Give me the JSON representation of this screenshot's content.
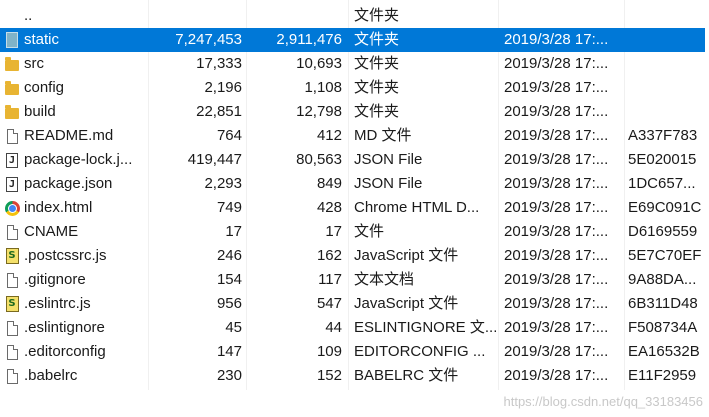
{
  "rows": [
    {
      "icon": "parent-folder-icon",
      "name": "..",
      "size": "",
      "packed": "",
      "type": "文件夹",
      "modified": "",
      "crc": ""
    },
    {
      "icon": "folder-icon",
      "name": "static",
      "size": "7,247,453",
      "packed": "2,911,476",
      "type": "文件夹",
      "modified": "2019/3/28 17:...",
      "crc": "",
      "selected": true
    },
    {
      "icon": "folder-icon",
      "name": "src",
      "size": "17,333",
      "packed": "10,693",
      "type": "文件夹",
      "modified": "2019/3/28 17:...",
      "crc": ""
    },
    {
      "icon": "folder-icon",
      "name": "config",
      "size": "2,196",
      "packed": "1,108",
      "type": "文件夹",
      "modified": "2019/3/28 17:...",
      "crc": ""
    },
    {
      "icon": "folder-icon",
      "name": "build",
      "size": "22,851",
      "packed": "12,798",
      "type": "文件夹",
      "modified": "2019/3/28 17:...",
      "crc": ""
    },
    {
      "icon": "file-icon",
      "name": "README.md",
      "size": "764",
      "packed": "412",
      "type": "MD 文件",
      "modified": "2019/3/28 17:...",
      "crc": "A337F783"
    },
    {
      "icon": "json-file-icon",
      "name": "package-lock.j...",
      "size": "419,447",
      "packed": "80,563",
      "type": "JSON File",
      "modified": "2019/3/28 17:...",
      "crc": "5E020015"
    },
    {
      "icon": "json-file-icon",
      "name": "package.json",
      "size": "2,293",
      "packed": "849",
      "type": "JSON File",
      "modified": "2019/3/28 17:...",
      "crc": "1DC657..."
    },
    {
      "icon": "chrome-icon",
      "name": "index.html",
      "size": "749",
      "packed": "428",
      "type": "Chrome HTML D...",
      "modified": "2019/3/28 17:...",
      "crc": "E69C091C"
    },
    {
      "icon": "file-icon",
      "name": "CNAME",
      "size": "17",
      "packed": "17",
      "type": "文件",
      "modified": "2019/3/28 17:...",
      "crc": "D6169559"
    },
    {
      "icon": "js-file-icon",
      "name": ".postcssrc.js",
      "size": "246",
      "packed": "162",
      "type": "JavaScript 文件",
      "modified": "2019/3/28 17:...",
      "crc": "5E7C70EF"
    },
    {
      "icon": "file-icon",
      "name": ".gitignore",
      "size": "154",
      "packed": "117",
      "type": "文本文档",
      "modified": "2019/3/28 17:...",
      "crc": "9A88DA..."
    },
    {
      "icon": "js-file-icon",
      "name": ".eslintrc.js",
      "size": "956",
      "packed": "547",
      "type": "JavaScript 文件",
      "modified": "2019/3/28 17:...",
      "crc": "6B311D48"
    },
    {
      "icon": "file-icon",
      "name": ".eslintignore",
      "size": "45",
      "packed": "44",
      "type": "ESLINTIGNORE 文...",
      "modified": "2019/3/28 17:...",
      "crc": "F508734A"
    },
    {
      "icon": "file-icon",
      "name": ".editorconfig",
      "size": "147",
      "packed": "109",
      "type": "EDITORCONFIG ...",
      "modified": "2019/3/28 17:...",
      "crc": "EA16532B"
    },
    {
      "icon": "file-icon",
      "name": ".babelrc",
      "size": "230",
      "packed": "152",
      "type": "BABELRC 文件",
      "modified": "2019/3/28 17:...",
      "crc": "E11F2959"
    }
  ],
  "watermark": "https://blog.csdn.net/qq_33183456",
  "colors": {
    "selection": "#0078d7",
    "folder": "#e8b432"
  }
}
